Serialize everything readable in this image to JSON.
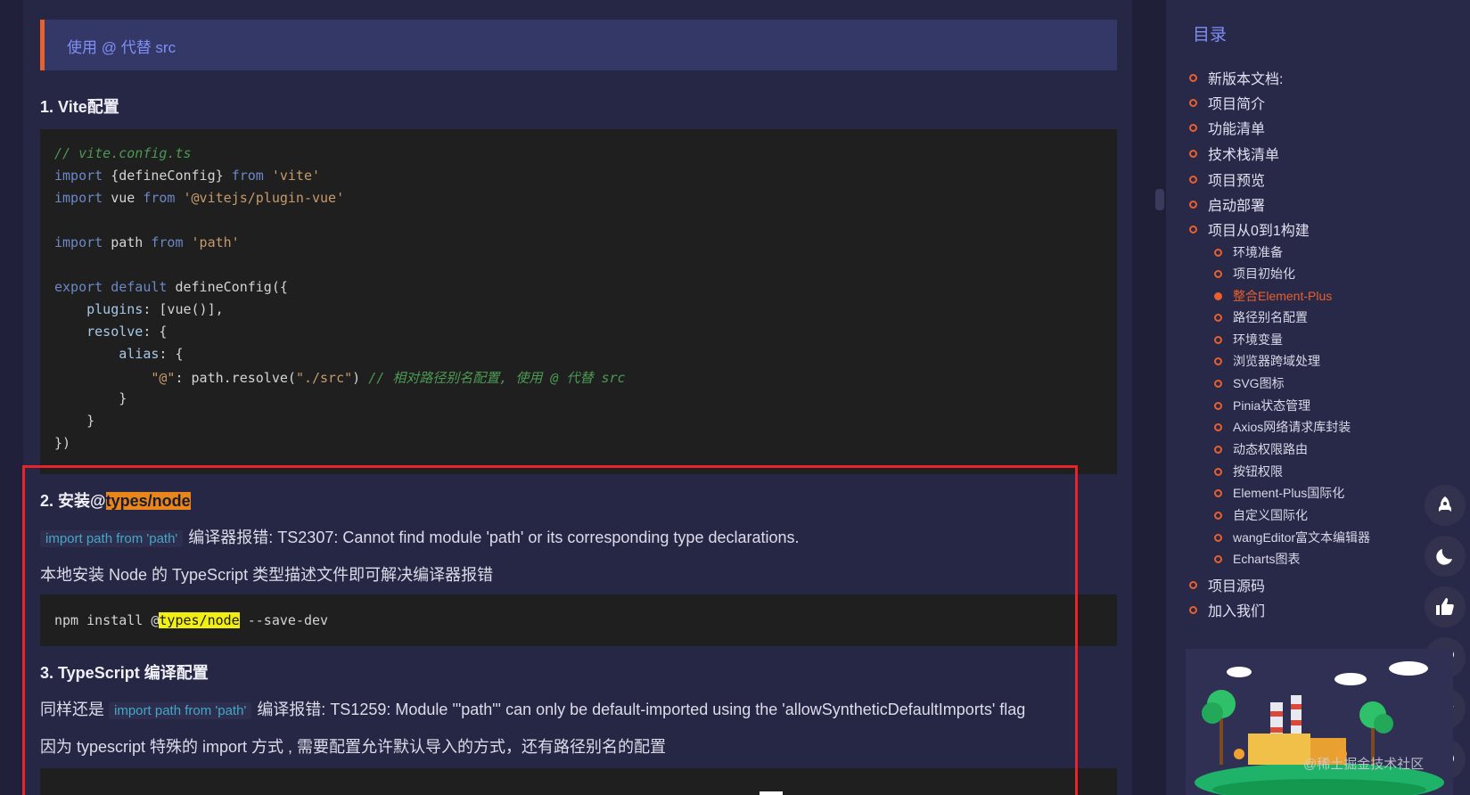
{
  "tip": {
    "text": "使用 @ 代替 src"
  },
  "sections": {
    "s1": {
      "title": "1. Vite配置"
    },
    "s2": {
      "title_prefix": "2. 安装@",
      "title_highlight": "types/node"
    },
    "s3": {
      "title": "3. TypeScript 编译配置"
    }
  },
  "code1": {
    "comment": "// vite.config.ts",
    "l2_kw1": "import",
    "l2_a": " {defineConfig} ",
    "l2_kw2": "from",
    "l2_str": " 'vite'",
    "l3_kw1": "import",
    "l3_a": " vue ",
    "l3_kw2": "from",
    "l3_str": " '@vitejs/plugin-vue'",
    "l5_kw1": "import",
    "l5_a": " path ",
    "l5_kw2": "from",
    "l5_str": " 'path'",
    "l7_kw1": "export",
    "l7_kw2": " default",
    "l7_a": " defineConfig({",
    "l8_prop": "    plugins",
    "l8_a": ": [vue()],",
    "l9_prop": "    resolve",
    "l9_a": ": {",
    "l10_prop": "        alias",
    "l10_a": ": {",
    "l11_str1": "            \"@\"",
    "l11_a": ": path.resolve(",
    "l11_str2": "\"./src\"",
    "l11_b": ") ",
    "l11_comment": "// 相对路径别名配置, 使用 @ 代替 src",
    "l12": "        }",
    "l13": "    }",
    "l14": "})"
  },
  "para1": {
    "code": "import path from 'path'",
    "text": "编译器报错: TS2307: Cannot find module 'path' or its corresponding type declarations."
  },
  "para2": {
    "text": "本地安装 Node 的 TypeScript 类型描述文件即可解决编译器报错"
  },
  "code2": {
    "prefix": "npm install @",
    "highlight": "types/node",
    "suffix": " --save-dev"
  },
  "para3": {
    "prefix": "同样还是",
    "code": "import path from 'path'",
    "text": "编译报错: TS1259: Module '\"path\"' can only be default-imported using the 'allowSyntheticDefaultImports' flag"
  },
  "para4": {
    "text": "因为 typescript 特殊的 import 方式 , 需要配置允许默认导入的方式，还有路径别名的配置"
  },
  "toc": {
    "title": "目录",
    "items": [
      "新版本文档:",
      "项目简介",
      "功能清单",
      "技术栈清单",
      "项目预览",
      "启动部署",
      "项目从0到1构建",
      "环境准备",
      "项目初始化",
      "整合Element-Plus",
      "路径别名配置",
      "环境变量",
      "浏览器跨域处理",
      "SVG图标",
      "Pinia状态管理",
      "Axios网络请求库封装",
      "动态权限路由",
      "按钮权限",
      "Element-Plus国际化",
      "自定义国际化",
      "wangEditor富文本编辑器",
      "Echarts图表",
      "项目源码",
      "加入我们"
    ],
    "active_index": 9
  },
  "float_buttons": [
    "rocket-icon",
    "moon-icon",
    "thumbs-up-icon",
    "heart-icon",
    "star-icon",
    "comment-icon"
  ],
  "watermark": "@稀土掘金技术社区",
  "colors": {
    "accent": "#e8602c",
    "link": "#7f8ff4",
    "highlight_border": "#e8232b"
  }
}
